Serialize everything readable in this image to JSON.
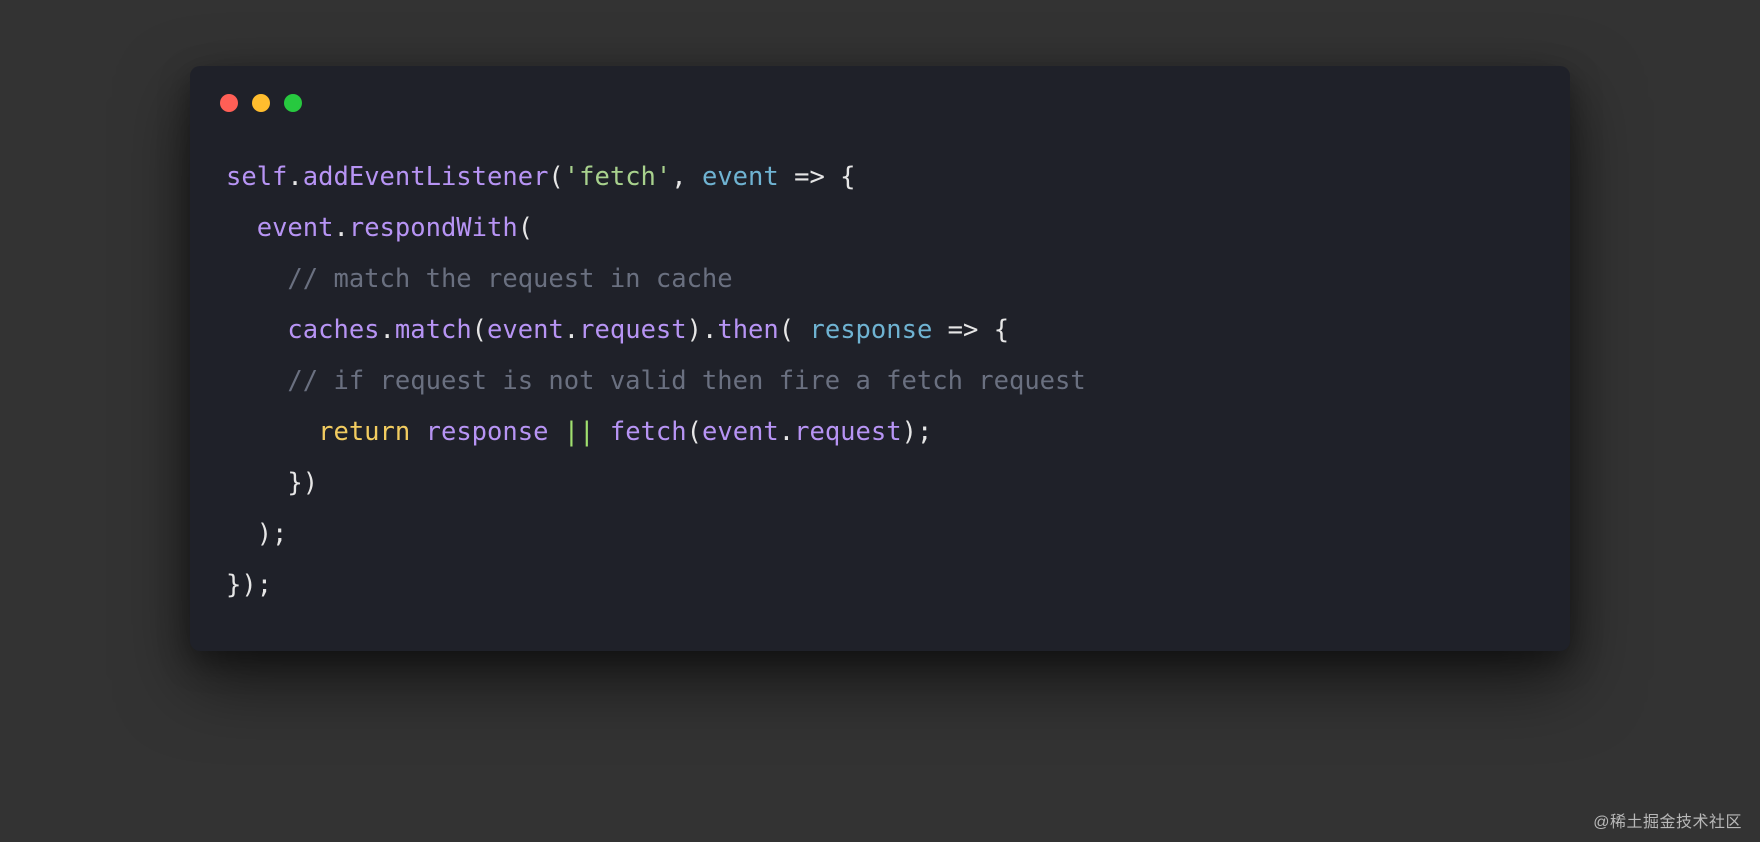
{
  "watermark": "@稀土掘金技术社区",
  "code": {
    "lines": [
      [
        {
          "cls": "c-ident",
          "t": "self"
        },
        {
          "cls": "c-punct",
          "t": "."
        },
        {
          "cls": "c-ident",
          "t": "addEventListener"
        },
        {
          "cls": "c-punct",
          "t": "("
        },
        {
          "cls": "c-string",
          "t": "'fetch'"
        },
        {
          "cls": "c-punct",
          "t": ", "
        },
        {
          "cls": "c-param",
          "t": "event"
        },
        {
          "cls": "c-punct",
          "t": " "
        },
        {
          "cls": "c-arrow",
          "t": "=>"
        },
        {
          "cls": "c-punct",
          "t": " {"
        }
      ],
      [
        {
          "cls": "c-punct",
          "t": "  "
        },
        {
          "cls": "c-ident",
          "t": "event"
        },
        {
          "cls": "c-punct",
          "t": "."
        },
        {
          "cls": "c-ident",
          "t": "respondWith"
        },
        {
          "cls": "c-punct",
          "t": "("
        }
      ],
      [
        {
          "cls": "c-punct",
          "t": "    "
        },
        {
          "cls": "c-comment",
          "t": "// match the request in cache"
        }
      ],
      [
        {
          "cls": "c-punct",
          "t": "    "
        },
        {
          "cls": "c-ident",
          "t": "caches"
        },
        {
          "cls": "c-punct",
          "t": "."
        },
        {
          "cls": "c-ident",
          "t": "match"
        },
        {
          "cls": "c-punct",
          "t": "("
        },
        {
          "cls": "c-ident",
          "t": "event"
        },
        {
          "cls": "c-punct",
          "t": "."
        },
        {
          "cls": "c-ident",
          "t": "request"
        },
        {
          "cls": "c-punct",
          "t": ")."
        },
        {
          "cls": "c-ident",
          "t": "then"
        },
        {
          "cls": "c-punct",
          "t": "( "
        },
        {
          "cls": "c-param",
          "t": "response"
        },
        {
          "cls": "c-punct",
          "t": " "
        },
        {
          "cls": "c-arrow",
          "t": "=>"
        },
        {
          "cls": "c-punct",
          "t": " {"
        }
      ],
      [
        {
          "cls": "c-punct",
          "t": "    "
        },
        {
          "cls": "c-comment",
          "t": "// if request is not valid then fire a fetch request"
        }
      ],
      [
        {
          "cls": "c-punct",
          "t": "      "
        },
        {
          "cls": "c-keyword",
          "t": "return"
        },
        {
          "cls": "c-punct",
          "t": " "
        },
        {
          "cls": "c-ident",
          "t": "response"
        },
        {
          "cls": "c-punct",
          "t": " "
        },
        {
          "cls": "c-op",
          "t": "||"
        },
        {
          "cls": "c-punct",
          "t": " "
        },
        {
          "cls": "c-call",
          "t": "fetch"
        },
        {
          "cls": "c-punct",
          "t": "("
        },
        {
          "cls": "c-ident",
          "t": "event"
        },
        {
          "cls": "c-punct",
          "t": "."
        },
        {
          "cls": "c-ident",
          "t": "request"
        },
        {
          "cls": "c-punct",
          "t": ");"
        }
      ],
      [
        {
          "cls": "c-punct",
          "t": "    })"
        }
      ],
      [
        {
          "cls": "c-punct",
          "t": "  );"
        }
      ],
      [
        {
          "cls": "c-punct",
          "t": "});"
        }
      ]
    ]
  }
}
